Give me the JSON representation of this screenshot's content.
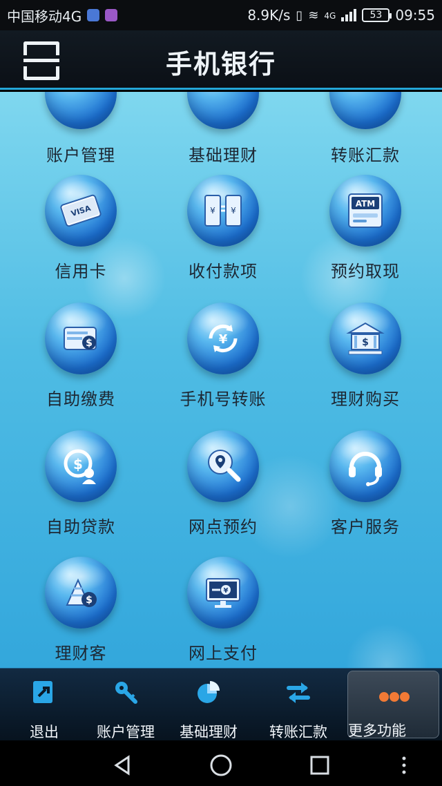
{
  "status_bar": {
    "carrier": "中国移动4G",
    "speed": "8.9K/s",
    "network": "4G",
    "battery": "53",
    "time": "09:55"
  },
  "header": {
    "title": "手机银行"
  },
  "top_row": [
    {
      "label": "账户管理",
      "icon": "account-icon"
    },
    {
      "label": "基础理财",
      "icon": "finance-icon"
    },
    {
      "label": "转账汇款",
      "icon": "transfer-icon"
    }
  ],
  "grid": {
    "row1": [
      {
        "label": "信用卡",
        "icon": "credit-card-icon",
        "card_text": "VISA"
      },
      {
        "label": "收付款项",
        "icon": "payment-icon"
      },
      {
        "label": "预约取现",
        "icon": "atm-icon",
        "atm_text": "ATM"
      }
    ],
    "row2": [
      {
        "label": "自助缴费",
        "icon": "bill-payment-icon"
      },
      {
        "label": "手机号转账",
        "icon": "phone-transfer-icon"
      },
      {
        "label": "理财购买",
        "icon": "bank-building-icon"
      }
    ],
    "row3": [
      {
        "label": "自助贷款",
        "icon": "loan-icon"
      },
      {
        "label": "网点预约",
        "icon": "branch-location-icon"
      },
      {
        "label": "客户服务",
        "icon": "headset-icon"
      }
    ],
    "row4": [
      {
        "label": "理财客",
        "icon": "pyramid-coin-icon"
      },
      {
        "label": "网上支付",
        "icon": "online-payment-icon"
      }
    ]
  },
  "bottom_bar": {
    "items": [
      {
        "label": "退出",
        "icon": "logout-icon"
      },
      {
        "label": "账户管理",
        "icon": "key-icon"
      },
      {
        "label": "基础理财",
        "icon": "pie-chart-icon"
      },
      {
        "label": "转账汇款",
        "icon": "transfer-arrows-icon"
      },
      {
        "label": "更多功能",
        "icon": "more-dots-icon"
      }
    ]
  },
  "colors": {
    "accent": "#24a7d8",
    "more_dots": "#f27a35"
  }
}
